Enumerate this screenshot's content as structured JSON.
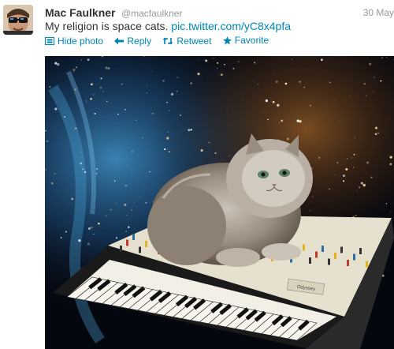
{
  "tweet": {
    "author_name": "Mac Faulkner",
    "author_handle": "@macfaulkner",
    "timestamp": "30 May",
    "text": "My religion is space cats.",
    "link_text": "pic.twitter.com/yC8x4pfa",
    "link_color": "#0084b4"
  },
  "actions": {
    "hide_photo": "Hide photo",
    "reply": "Reply",
    "retweet": "Retweet",
    "favorite": "Favorite"
  },
  "icons": {
    "hide_photo": "photo-icon",
    "reply": "reply-arrow-icon",
    "retweet": "retweet-icon",
    "favorite": "star-icon"
  },
  "media": {
    "synth_brand": "Odyssey"
  }
}
